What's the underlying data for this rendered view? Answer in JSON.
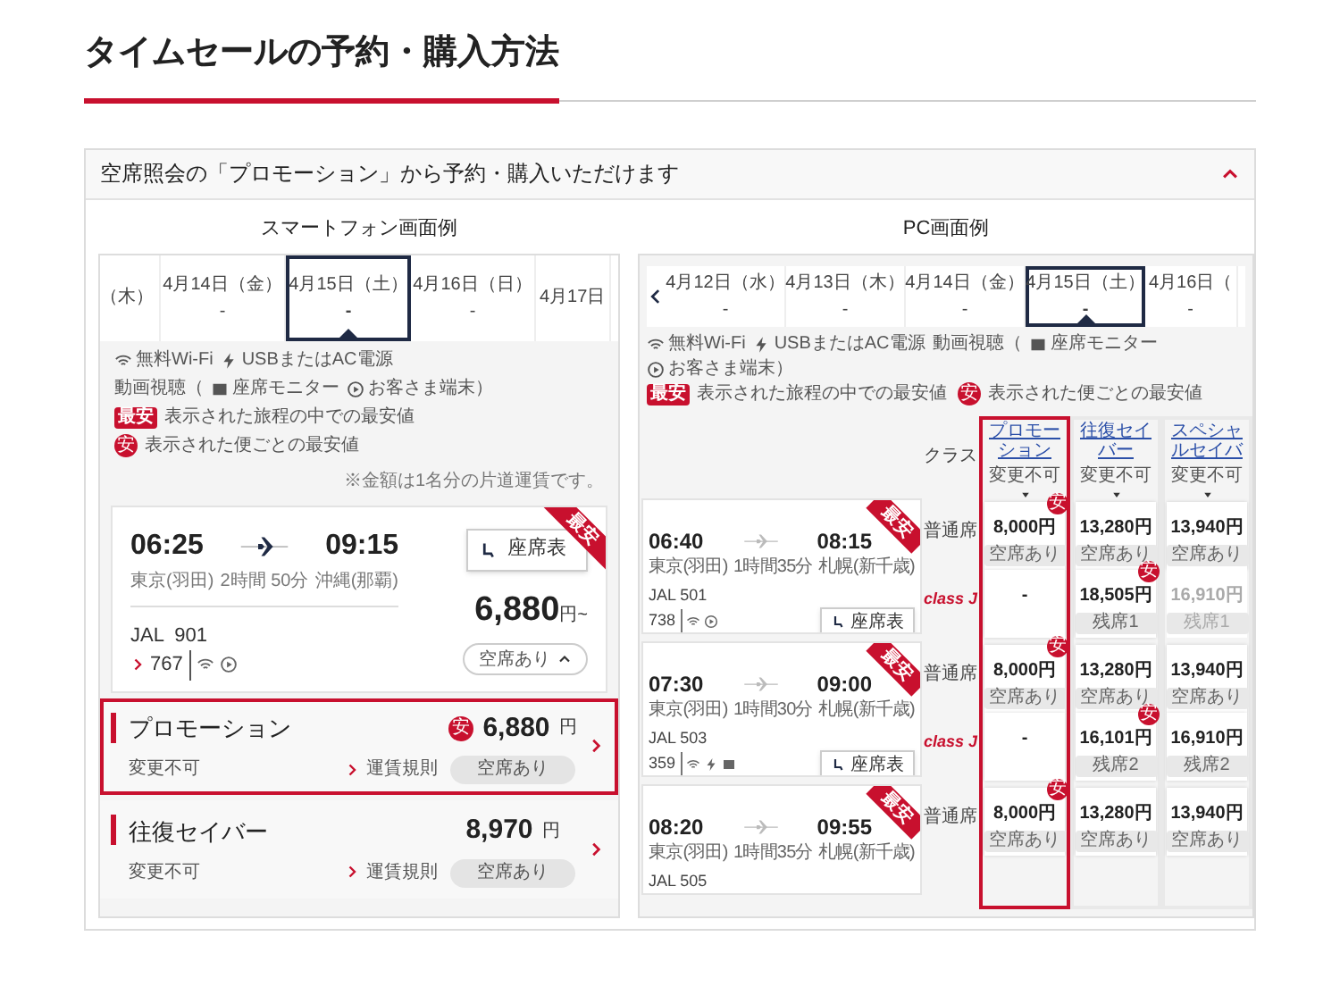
{
  "page_title": "タイムセールの予約・購入方法",
  "accordion": {
    "title": "空席照会の「プロモーション」から予約・購入いただけます",
    "expanded": true
  },
  "smartphone": {
    "caption": "スマートフォン画面例",
    "dates": [
      {
        "label": "（木）",
        "selected": false
      },
      {
        "label": "4月14日（金）",
        "price": "-",
        "selected": false
      },
      {
        "label": "4月15日（土）",
        "price": "-",
        "selected": true
      },
      {
        "label": "4月16日（日）",
        "price": "-",
        "selected": false
      },
      {
        "label": "4月17日",
        "selected": false
      }
    ],
    "amenities": [
      {
        "kind": "wifi",
        "label": "無料Wi-Fi"
      },
      {
        "kind": "power",
        "label": "USBまたはAC電源"
      }
    ],
    "video": {
      "prefix": "動画視聴（",
      "items": [
        {
          "kind": "monitor",
          "label": "座席モニター"
        },
        {
          "kind": "play",
          "label": "お客さま端末）"
        }
      ]
    },
    "legend": [
      {
        "kind": "ribbon",
        "badge": "最安",
        "text": "表示された旅程の中での最安値"
      },
      {
        "kind": "circle",
        "badge": "安",
        "text": "表示された便ごとの最安値"
      }
    ],
    "note": "※金額は1名分の片道運賃です。",
    "flight": {
      "badge": "最安",
      "departure_time": "06:25",
      "departure_airport": "東京(羽田)",
      "duration": "2時間 50分",
      "arrival_time": "09:15",
      "arrival_airport": "沖縄(那覇)",
      "flight_number": "JAL  901",
      "aircraft": "767",
      "amenities": [
        {
          "kind": "wifi"
        },
        {
          "kind": "play"
        }
      ],
      "seat_map_button": "座席表",
      "price": "6,880",
      "price_unit": "円~",
      "availability": "空席あり",
      "expanded": true
    },
    "fares": [
      {
        "name": "プロモーション",
        "condition": "変更不可",
        "rules_link": "運賃規則",
        "cheapest_mark": "安",
        "price": "6,880",
        "unit": "円",
        "availability": "空席あり",
        "selected": true
      },
      {
        "name": "往復セイバー",
        "condition": "変更不可",
        "rules_link": "運賃規則",
        "price": "8,970",
        "unit": "円",
        "availability": "空席あり",
        "selected": false
      }
    ]
  },
  "pc": {
    "caption": "PC画面例",
    "dates": [
      {
        "label": "4月12日（水）",
        "price": "-",
        "selected": false
      },
      {
        "label": "4月13日（木）",
        "price": "-",
        "selected": false
      },
      {
        "label": "4月14日（金）",
        "price": "-",
        "selected": false
      },
      {
        "label": "4月15日（土）",
        "price": "-",
        "selected": true
      },
      {
        "label": "4月16日（",
        "price": "-",
        "selected": false
      }
    ],
    "amenities": [
      {
        "kind": "wifi",
        "label": "無料Wi-Fi"
      },
      {
        "kind": "power",
        "label": "USBまたはAC電源"
      }
    ],
    "video": {
      "prefix": "動画視聴（",
      "items": [
        {
          "kind": "monitor",
          "label": "座席モニター"
        },
        {
          "kind": "play",
          "label": "お客さま端末）"
        }
      ]
    },
    "legend": [
      {
        "kind": "ribbon",
        "badge": "最安",
        "text": "表示された旅程の中での最安値"
      },
      {
        "kind": "circle",
        "badge": "安",
        "text": "表示された便ごとの最安値"
      }
    ],
    "class_header": "クラス",
    "fare_columns": [
      {
        "name": "プロモーション",
        "condition": "変更不可",
        "selected": true
      },
      {
        "name": "往復セイバー",
        "condition": "変更不可",
        "selected": false
      },
      {
        "name": "スペシャルセイバ",
        "condition": "変更不可",
        "selected": false
      }
    ],
    "flights": [
      {
        "badge": "最安",
        "departure_time": "06:40",
        "departure_airport": "東京(羽田)",
        "duration": "1時間35分",
        "arrival_time": "08:15",
        "arrival_airport": "札幌(新千歳)",
        "flight_number": "JAL 501",
        "aircraft": "738",
        "amenities": [
          {
            "kind": "wifi"
          },
          {
            "kind": "play"
          }
        ],
        "seat_map_button": "座席表",
        "classes": [
          {
            "kind": "text",
            "name": "普通席",
            "fares": [
              {
                "price": "8,000円",
                "availability": "空席あり",
                "cheapest_mark": "安",
                "dimmed": false
              },
              {
                "price": "13,280円",
                "availability": "空席あり",
                "dimmed": false
              },
              {
                "price": "13,940円",
                "availability": "空席あり",
                "dimmed": false
              }
            ]
          },
          {
            "kind": "logo",
            "name": "class J",
            "fares": [
              {
                "price": "-",
                "dimmed": false
              },
              {
                "price": "18,505円",
                "availability": "残席1",
                "cheapest_mark": "安",
                "dimmed": false
              },
              {
                "price": "16,910円",
                "availability": "残席1",
                "dimmed": true
              }
            ]
          }
        ]
      },
      {
        "badge": "最安",
        "departure_time": "07:30",
        "departure_airport": "東京(羽田)",
        "duration": "1時間30分",
        "arrival_time": "09:00",
        "arrival_airport": "札幌(新千歳)",
        "flight_number": "JAL 503",
        "aircraft": "359",
        "amenities": [
          {
            "kind": "wifi"
          },
          {
            "kind": "power"
          },
          {
            "kind": "monitor"
          }
        ],
        "seat_map_button": "座席表",
        "classes": [
          {
            "kind": "text",
            "name": "普通席",
            "fares": [
              {
                "price": "8,000円",
                "availability": "空席あり",
                "cheapest_mark": "安",
                "dimmed": false
              },
              {
                "price": "13,280円",
                "availability": "空席あり",
                "dimmed": false
              },
              {
                "price": "13,940円",
                "availability": "空席あり",
                "dimmed": false
              }
            ]
          },
          {
            "kind": "logo",
            "name": "class J",
            "fares": [
              {
                "price": "-",
                "dimmed": false
              },
              {
                "price": "16,101円",
                "availability": "残席2",
                "cheapest_mark": "安",
                "dimmed": false
              },
              {
                "price": "16,910円",
                "availability": "残席2",
                "dimmed": false
              }
            ]
          }
        ]
      },
      {
        "badge": "最安",
        "departure_time": "08:20",
        "departure_airport": "東京(羽田)",
        "duration": "1時間35分",
        "arrival_time": "09:55",
        "arrival_airport": "札幌(新千歳)",
        "flight_number": "JAL 505",
        "classes": [
          {
            "kind": "text",
            "name": "普通席",
            "fares": [
              {
                "price": "8,000円",
                "availability": "空席あり",
                "cheapest_mark": "安",
                "dimmed": false
              },
              {
                "price": "13,280円",
                "availability": "空席あり",
                "dimmed": false
              },
              {
                "price": "13,940円",
                "availability": "空席あり",
                "dimmed": false
              }
            ]
          }
        ]
      }
    ]
  }
}
